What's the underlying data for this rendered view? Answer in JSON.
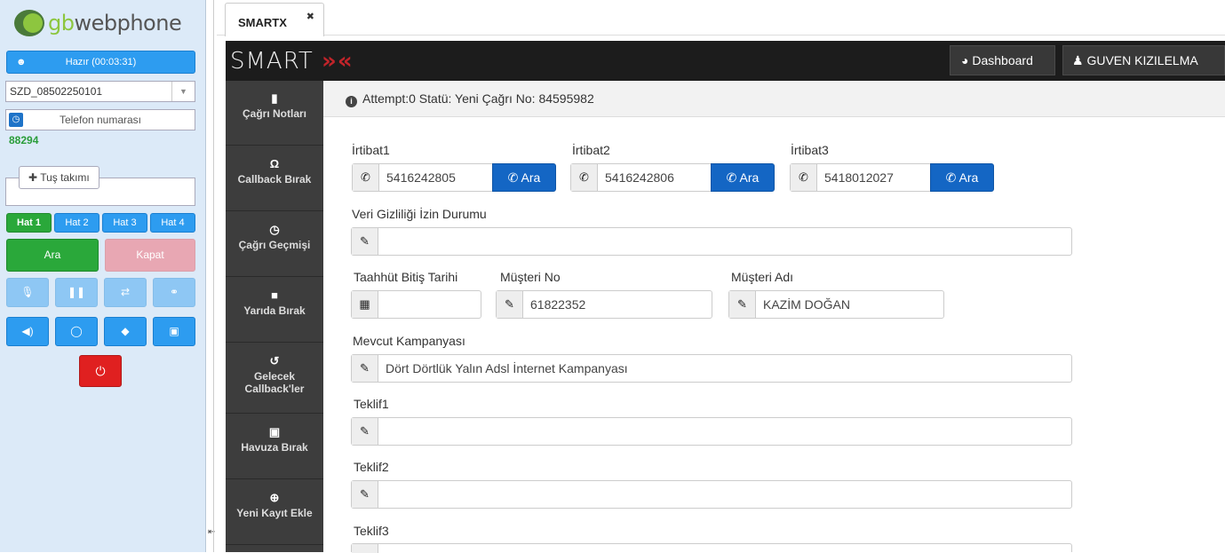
{
  "phone": {
    "logo_g": "gb",
    "logo_w": "webphone",
    "status": "Hazır (00:03:31)",
    "line_select": "SZD_08502250101",
    "phone_placeholder": "Telefon numarası",
    "extension": "88294",
    "keypad_label": "Tuş takımı",
    "lines": [
      "Hat 1",
      "Hat 2",
      "Hat 3",
      "Hat 4"
    ],
    "call_label": "Ara",
    "hangup_label": "Kapat"
  },
  "tab": {
    "name": "SMARTX",
    "close": "✖"
  },
  "smart": {
    "brand": "SMART",
    "dashboard_label": "Dashboard",
    "user_name": "GUVEN KIZILELMA",
    "nav": [
      {
        "label": "Çağrı Notları"
      },
      {
        "label": "Callback Bırak"
      },
      {
        "label": "Çağrı Geçmişi"
      },
      {
        "label": "Yarıda Bırak"
      },
      {
        "label": "Gelecek Callback'ler"
      },
      {
        "label": "Havuza Bırak"
      },
      {
        "label": "Yeni Kayıt Ekle"
      }
    ],
    "info": "Attempt:0 Statü: Yeni Çağrı No: 84595982"
  },
  "form": {
    "contacts": [
      {
        "label": "İrtibat1",
        "value": "5416242805",
        "button": "Ara"
      },
      {
        "label": "İrtibat2",
        "value": "5416242806",
        "button": "Ara"
      },
      {
        "label": "İrtibat3",
        "value": "5418012027",
        "button": "Ara"
      }
    ],
    "privacy_label": "Veri Gizliliği İzin Durumu",
    "privacy_value": "",
    "commit_label": "Taahhüt Bitiş Tarihi",
    "commit_value": "",
    "customer_no_label": "Müşteri No",
    "customer_no": "61822352",
    "customer_name_label": "Müşteri Adı",
    "customer_name": "KAZİM DOĞAN",
    "campaign_label": "Mevcut Kampanyası",
    "campaign": "Dört Dörtlük Yalın Adsl İnternet Kampanyası",
    "offer1_label": "Teklif1",
    "offer1": "",
    "offer2_label": "Teklif2",
    "offer2": "",
    "offer3_label": "Teklif3",
    "offer3": ""
  }
}
